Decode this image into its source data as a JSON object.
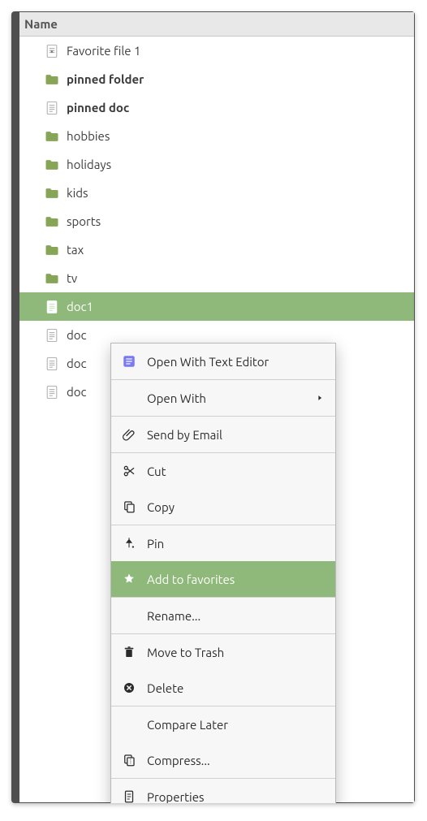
{
  "colors": {
    "selection": "#8fb97a",
    "folder": "#87a556",
    "frame": "#4f4f4f",
    "header_bg": "#e8e8e8"
  },
  "header": {
    "title": "Name"
  },
  "items": [
    {
      "kind": "fav-doc",
      "label": "Favorite file 1",
      "bold": false
    },
    {
      "kind": "folder",
      "label": "pinned folder",
      "bold": true
    },
    {
      "kind": "doc",
      "label": "pinned doc",
      "bold": true
    },
    {
      "kind": "folder",
      "label": "hobbies",
      "bold": false
    },
    {
      "kind": "folder",
      "label": "holidays",
      "bold": false
    },
    {
      "kind": "folder",
      "label": "kids",
      "bold": false
    },
    {
      "kind": "folder",
      "label": "sports",
      "bold": false
    },
    {
      "kind": "folder",
      "label": "tax",
      "bold": false
    },
    {
      "kind": "folder",
      "label": "tv",
      "bold": false
    },
    {
      "kind": "doc",
      "label": "doc1",
      "bold": false,
      "selected": true
    },
    {
      "kind": "doc",
      "label": "doc",
      "bold": false
    },
    {
      "kind": "doc",
      "label": "doc",
      "bold": false
    },
    {
      "kind": "doc",
      "label": "doc",
      "bold": false
    }
  ],
  "menu": [
    {
      "icon": "text-editor",
      "label": "Open With Text Editor"
    },
    {
      "sep": true
    },
    {
      "icon": "",
      "label": "Open With",
      "submenu": true
    },
    {
      "sep": true
    },
    {
      "icon": "paperclip",
      "label": "Send by Email"
    },
    {
      "sep": true
    },
    {
      "icon": "scissors",
      "label": "Cut"
    },
    {
      "icon": "copy",
      "label": "Copy"
    },
    {
      "sep": true
    },
    {
      "icon": "pin",
      "label": "Pin"
    },
    {
      "icon": "star",
      "label": "Add to favorites",
      "highlight": true
    },
    {
      "sep": true
    },
    {
      "icon": "",
      "label": "Rename..."
    },
    {
      "sep": true
    },
    {
      "icon": "trash",
      "label": "Move to Trash"
    },
    {
      "icon": "delete",
      "label": "Delete"
    },
    {
      "sep": true
    },
    {
      "icon": "",
      "label": "Compare Later"
    },
    {
      "icon": "compress",
      "label": "Compress..."
    },
    {
      "sep": true
    },
    {
      "icon": "properties",
      "label": "Properties"
    }
  ]
}
